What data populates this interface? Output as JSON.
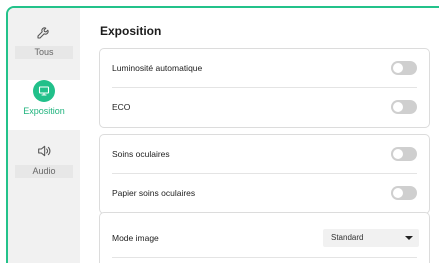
{
  "sidebar": {
    "items": [
      {
        "label": "Tous",
        "icon": "wrench-icon",
        "selected": false
      },
      {
        "label": "Exposition",
        "icon": "monitor-icon",
        "selected": true
      },
      {
        "label": "Audio",
        "icon": "speaker-icon",
        "selected": false
      }
    ]
  },
  "main": {
    "title": "Exposition",
    "groups": [
      {
        "rows": [
          {
            "label": "Luminosité automatique",
            "control": "toggle",
            "on": false
          },
          {
            "label": "ECO",
            "control": "toggle",
            "on": false
          }
        ]
      },
      {
        "rows": [
          {
            "label": "Soins oculaires",
            "control": "toggle",
            "on": false
          },
          {
            "label": "Papier soins oculaires",
            "control": "toggle",
            "on": false
          }
        ]
      },
      {
        "rows": [
          {
            "label": "Mode image",
            "control": "select",
            "value": "Standard"
          }
        ]
      }
    ]
  },
  "colors": {
    "accent": "#21c08a",
    "toggle_off": "#cfcfcf"
  }
}
